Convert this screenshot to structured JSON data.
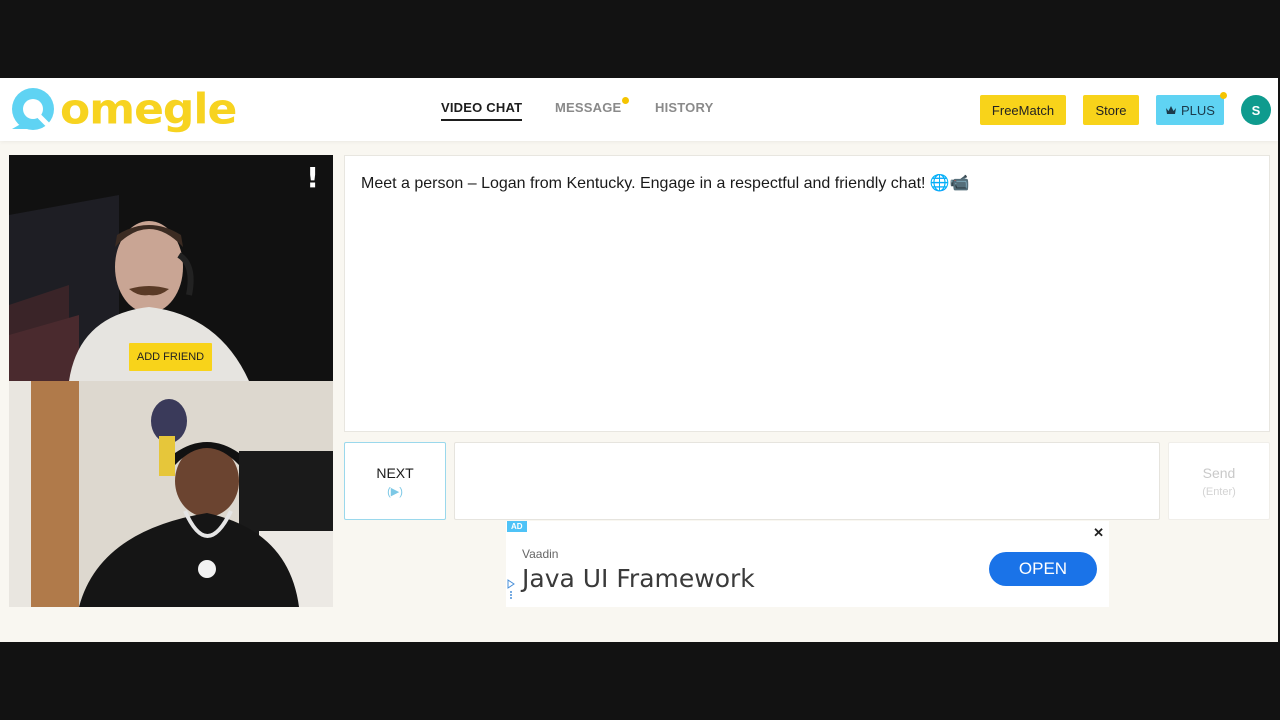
{
  "brand": {
    "name": "omegle",
    "logo_color": "#f7d320",
    "mark_color": "#5fd3f3"
  },
  "nav": {
    "video_chat": "VIDEO CHAT",
    "message": "MESSAGE",
    "history": "HISTORY"
  },
  "header_actions": {
    "freematch": "FreeMatch",
    "store": "Store",
    "plus": "PLUS",
    "plus_icon": "crown-icon",
    "avatar_initial": "S"
  },
  "video": {
    "report_label": "!",
    "add_friend": "ADD FRIEND"
  },
  "chat": {
    "message": "Meet a person – Logan from Kentucky. Engage in a respectful and friendly chat! 🌐📹",
    "input_value": ""
  },
  "controls": {
    "next_label": "NEXT",
    "next_hint": "(▶)",
    "send_label": "Send",
    "send_hint": "(Enter)"
  },
  "ad": {
    "badge": "AD",
    "close": "✕",
    "brand": "Vaadin",
    "title": "Java UI Framework",
    "cta": "OPEN"
  },
  "colors": {
    "accent_yellow": "#f8d31a",
    "plus_blue": "#5fd3f3",
    "avatar_teal": "#0f9b8e",
    "ad_button_blue": "#1a73e8"
  }
}
